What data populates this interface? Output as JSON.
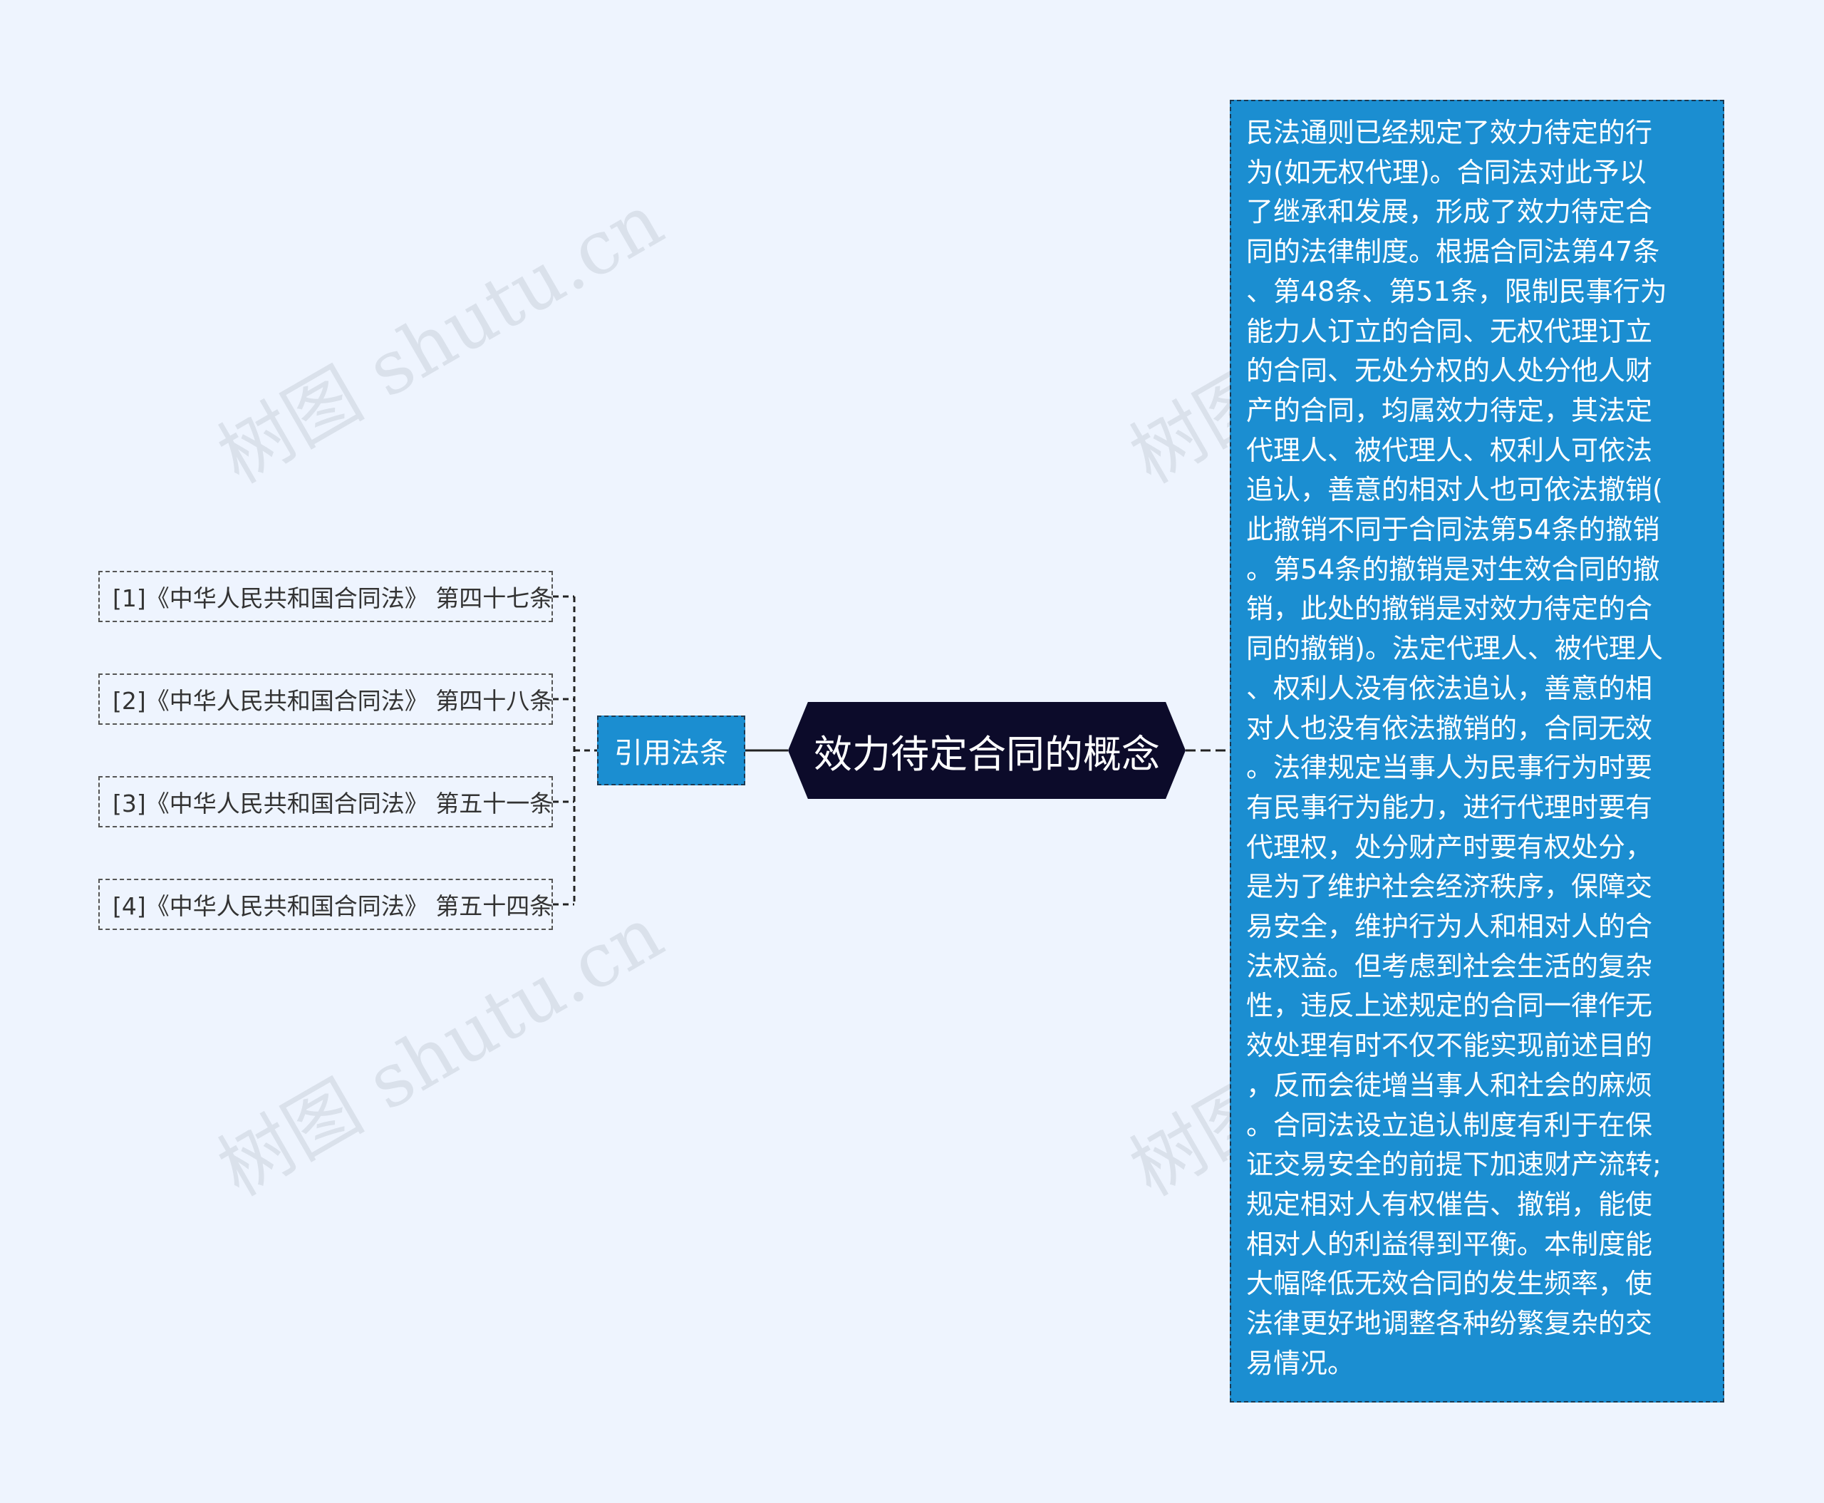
{
  "watermark_text": "树图 shutu.cn",
  "root": {
    "label": "效力待定合同的概念"
  },
  "citation_branch": {
    "label": "引用法条",
    "references": [
      "[1]《中华人民共和国合同法》 第四十七条",
      "[2]《中华人民共和国合同法》 第四十八条",
      "[3]《中华人民共和国合同法》 第五十一条",
      "[4]《中华人民共和国合同法》 第五十四条"
    ]
  },
  "description_lines": [
    "民法通则已经规定了效力待定的行",
    "为(如无权代理)。合同法对此予以",
    "了继承和发展，形成了效力待定合",
    "同的法律制度。根据合同法第47条",
    "、第48条、第51条，限制民事行为",
    "能力人订立的合同、无权代理订立",
    "的合同、无处分权的人处分他人财",
    "产的合同，均属效力待定，其法定",
    "代理人、被代理人、权利人可依法",
    "追认，善意的相对人也可依法撤销(",
    "此撤销不同于合同法第54条的撤销",
    "。第54条的撤销是对生效合同的撤",
    "销，此处的撤销是对效力待定的合",
    "同的撤销)。法定代理人、被代理人",
    "、权利人没有依法追认，善意的相",
    "对人也没有依法撤销的，合同无效",
    "。法律规定当事人为民事行为时要",
    "有民事行为能力，进行代理时要有",
    "代理权，处分财产时要有权处分，",
    "是为了维护社会经济秩序，保障交",
    "易安全，维护行为人和相对人的合",
    "法权益。但考虑到社会生活的复杂",
    "性，违反上述规定的合同一律作无",
    "效处理有时不仅不能实现前述目的",
    "，反而会徒增当事人和社会的麻烦",
    "。合同法设立追认制度有利于在保",
    "证交易安全的前提下加速财产流转;",
    "规定相对人有权催告、撤销，能使",
    "相对人的利益得到平衡。本制度能",
    "大幅降低无效合同的发生频率，使",
    "法律更好地调整各种纷繁复杂的交",
    "易情况。"
  ],
  "colors": {
    "background": "#eef4fe",
    "root_fill": "#0c0b2a",
    "branch_fill": "#1b8ed1",
    "connector": "#222222"
  }
}
